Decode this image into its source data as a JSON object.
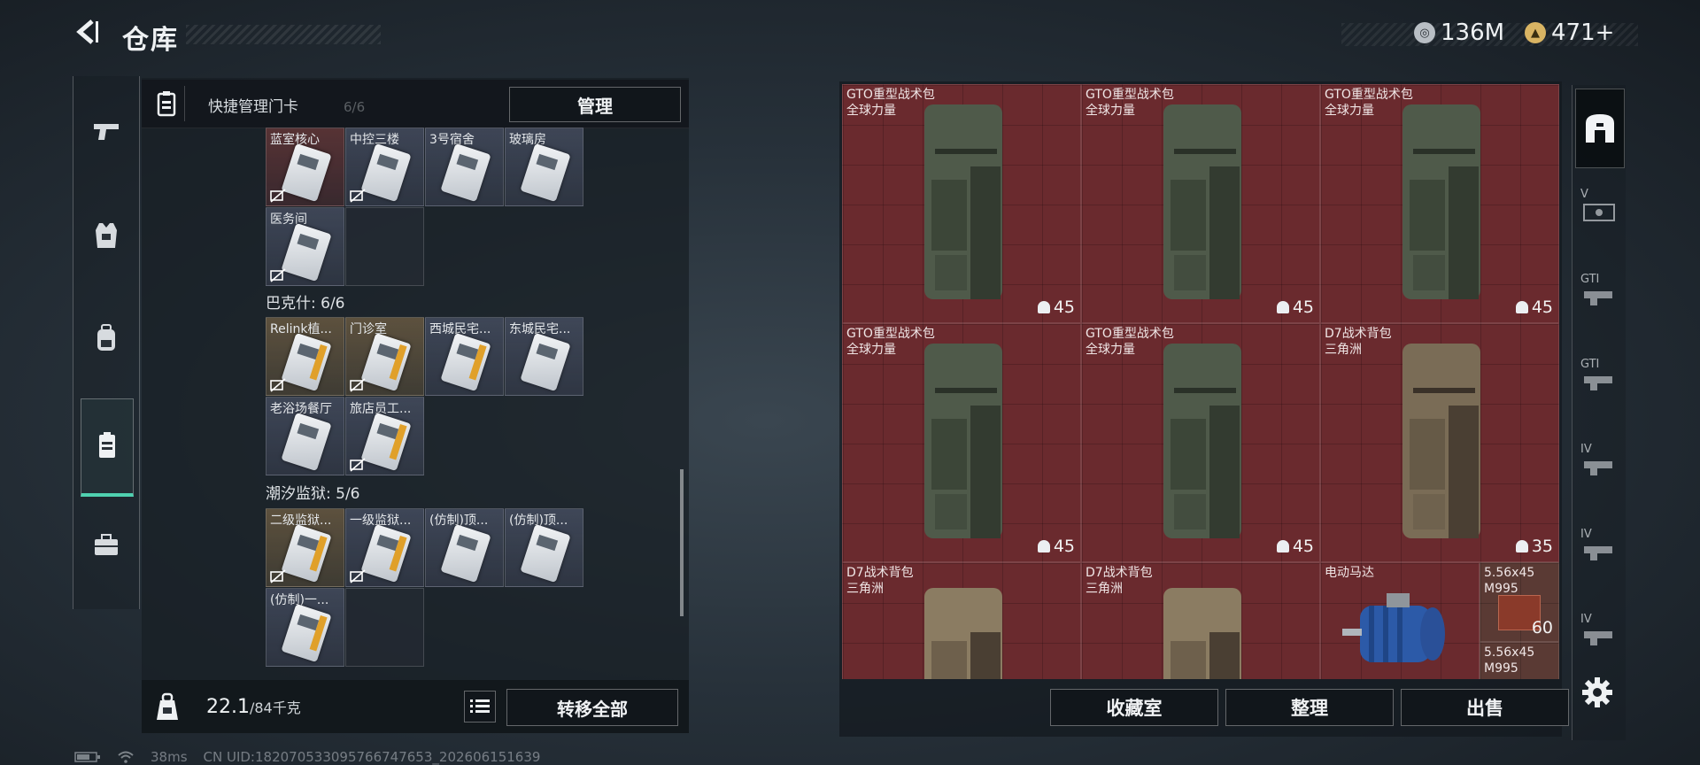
{
  "header": {
    "title": "仓库"
  },
  "currency": [
    {
      "icon": "silver-coin-icon",
      "value": "136M",
      "color": "#b8bec4"
    },
    {
      "icon": "gold-triangle-coin-icon",
      "value": "471+",
      "color": "#d9b463"
    }
  ],
  "left_nav": [
    {
      "icon": "pistol-icon"
    },
    {
      "icon": "armor-vest-icon"
    },
    {
      "icon": "backpack-icon"
    },
    {
      "icon": "keycard-icon",
      "active": true
    },
    {
      "icon": "toolbox-icon"
    }
  ],
  "keycard_panel": {
    "header_label": "快捷管理门卡",
    "ghost_text": "6/6",
    "manage_button": "管理",
    "groups": [
      {
        "title": "",
        "cards": [
          {
            "label": "蓝室核心",
            "style": "red"
          },
          {
            "label": "中控三楼",
            "style": "blue"
          },
          {
            "label": "3号宿舍",
            "style": "blue"
          },
          {
            "label": "玻璃房",
            "style": "blue"
          },
          {
            "label": "医务间",
            "style": "blue"
          }
        ]
      },
      {
        "title": "巴克什: 6/6",
        "cards": [
          {
            "label": "Relink植...",
            "style": "gold"
          },
          {
            "label": "门诊室",
            "style": "gold"
          },
          {
            "label": "西城民宅...",
            "style": "blue"
          },
          {
            "label": "东城民宅...",
            "style": "blue"
          },
          {
            "label": "老浴场餐厅",
            "style": "blue"
          },
          {
            "label": "旅店员工...",
            "style": "blue"
          }
        ]
      },
      {
        "title": "潮汐监狱: 5/6",
        "cards": [
          {
            "label": "二级监狱...",
            "style": "gold"
          },
          {
            "label": "一级监狱...",
            "style": "blue"
          },
          {
            "label": "(仿制)顶...",
            "style": "blue"
          },
          {
            "label": "(仿制)顶...",
            "style": "blue"
          },
          {
            "label": "(仿制)一...",
            "style": "blue"
          }
        ]
      }
    ],
    "weight_value": "22.1",
    "weight_limit": "/84千克",
    "transfer_all_button": "转移全部"
  },
  "inventory": {
    "items": [
      {
        "name": "GTO重型战术包",
        "subtitle": "全球力量",
        "count": "45",
        "tint": "#4f5a4a"
      },
      {
        "name": "GTO重型战术包",
        "subtitle": "全球力量",
        "count": "45",
        "tint": "#4f5a4a"
      },
      {
        "name": "GTO重型战术包",
        "subtitle": "全球力量",
        "count": "45",
        "tint": "#4f5a4a"
      },
      {
        "name": "GTO重型战术包",
        "subtitle": "全球力量",
        "count": "45",
        "tint": "#4f5a4a"
      },
      {
        "name": "GTO重型战术包",
        "subtitle": "全球力量",
        "count": "45",
        "tint": "#4f5a4a"
      },
      {
        "name": "D7战术背包",
        "subtitle": "三角洲",
        "count": "35",
        "tint": "#7a6c56"
      },
      {
        "name": "D7战术背包",
        "subtitle": "三角洲",
        "count": "",
        "tint": "#8b7c62"
      },
      {
        "name": "D7战术背包",
        "subtitle": "三角洲",
        "count": "",
        "tint": "#8b7c62"
      },
      {
        "name": "电动马达",
        "subtitle": "",
        "count": "",
        "tint": "#2c5aa8"
      }
    ],
    "ammo": [
      {
        "name": "5.56x45",
        "subtitle": "M995",
        "count": "60"
      },
      {
        "name": "5.56x45",
        "subtitle": "M995",
        "count": ""
      }
    ],
    "buttons": {
      "vault": "收藏室",
      "sort": "整理",
      "sell": "出售"
    }
  },
  "right_sidebar": [
    {
      "icon": "safe-box-icon",
      "label": "",
      "active": true
    },
    {
      "icon": "weapon-case-icon",
      "label": "V"
    },
    {
      "icon": "weapon-case-icon",
      "label": "GTI"
    },
    {
      "icon": "weapon-case-icon",
      "label": "GTI"
    },
    {
      "icon": "weapon-case-icon",
      "label": "IV"
    },
    {
      "icon": "weapon-case-icon",
      "label": "IV"
    },
    {
      "icon": "weapon-case-icon",
      "label": "IV"
    }
  ],
  "status": {
    "ping": "38ms",
    "uid": "CN UID:18207053309576674765​3_202606151639"
  }
}
